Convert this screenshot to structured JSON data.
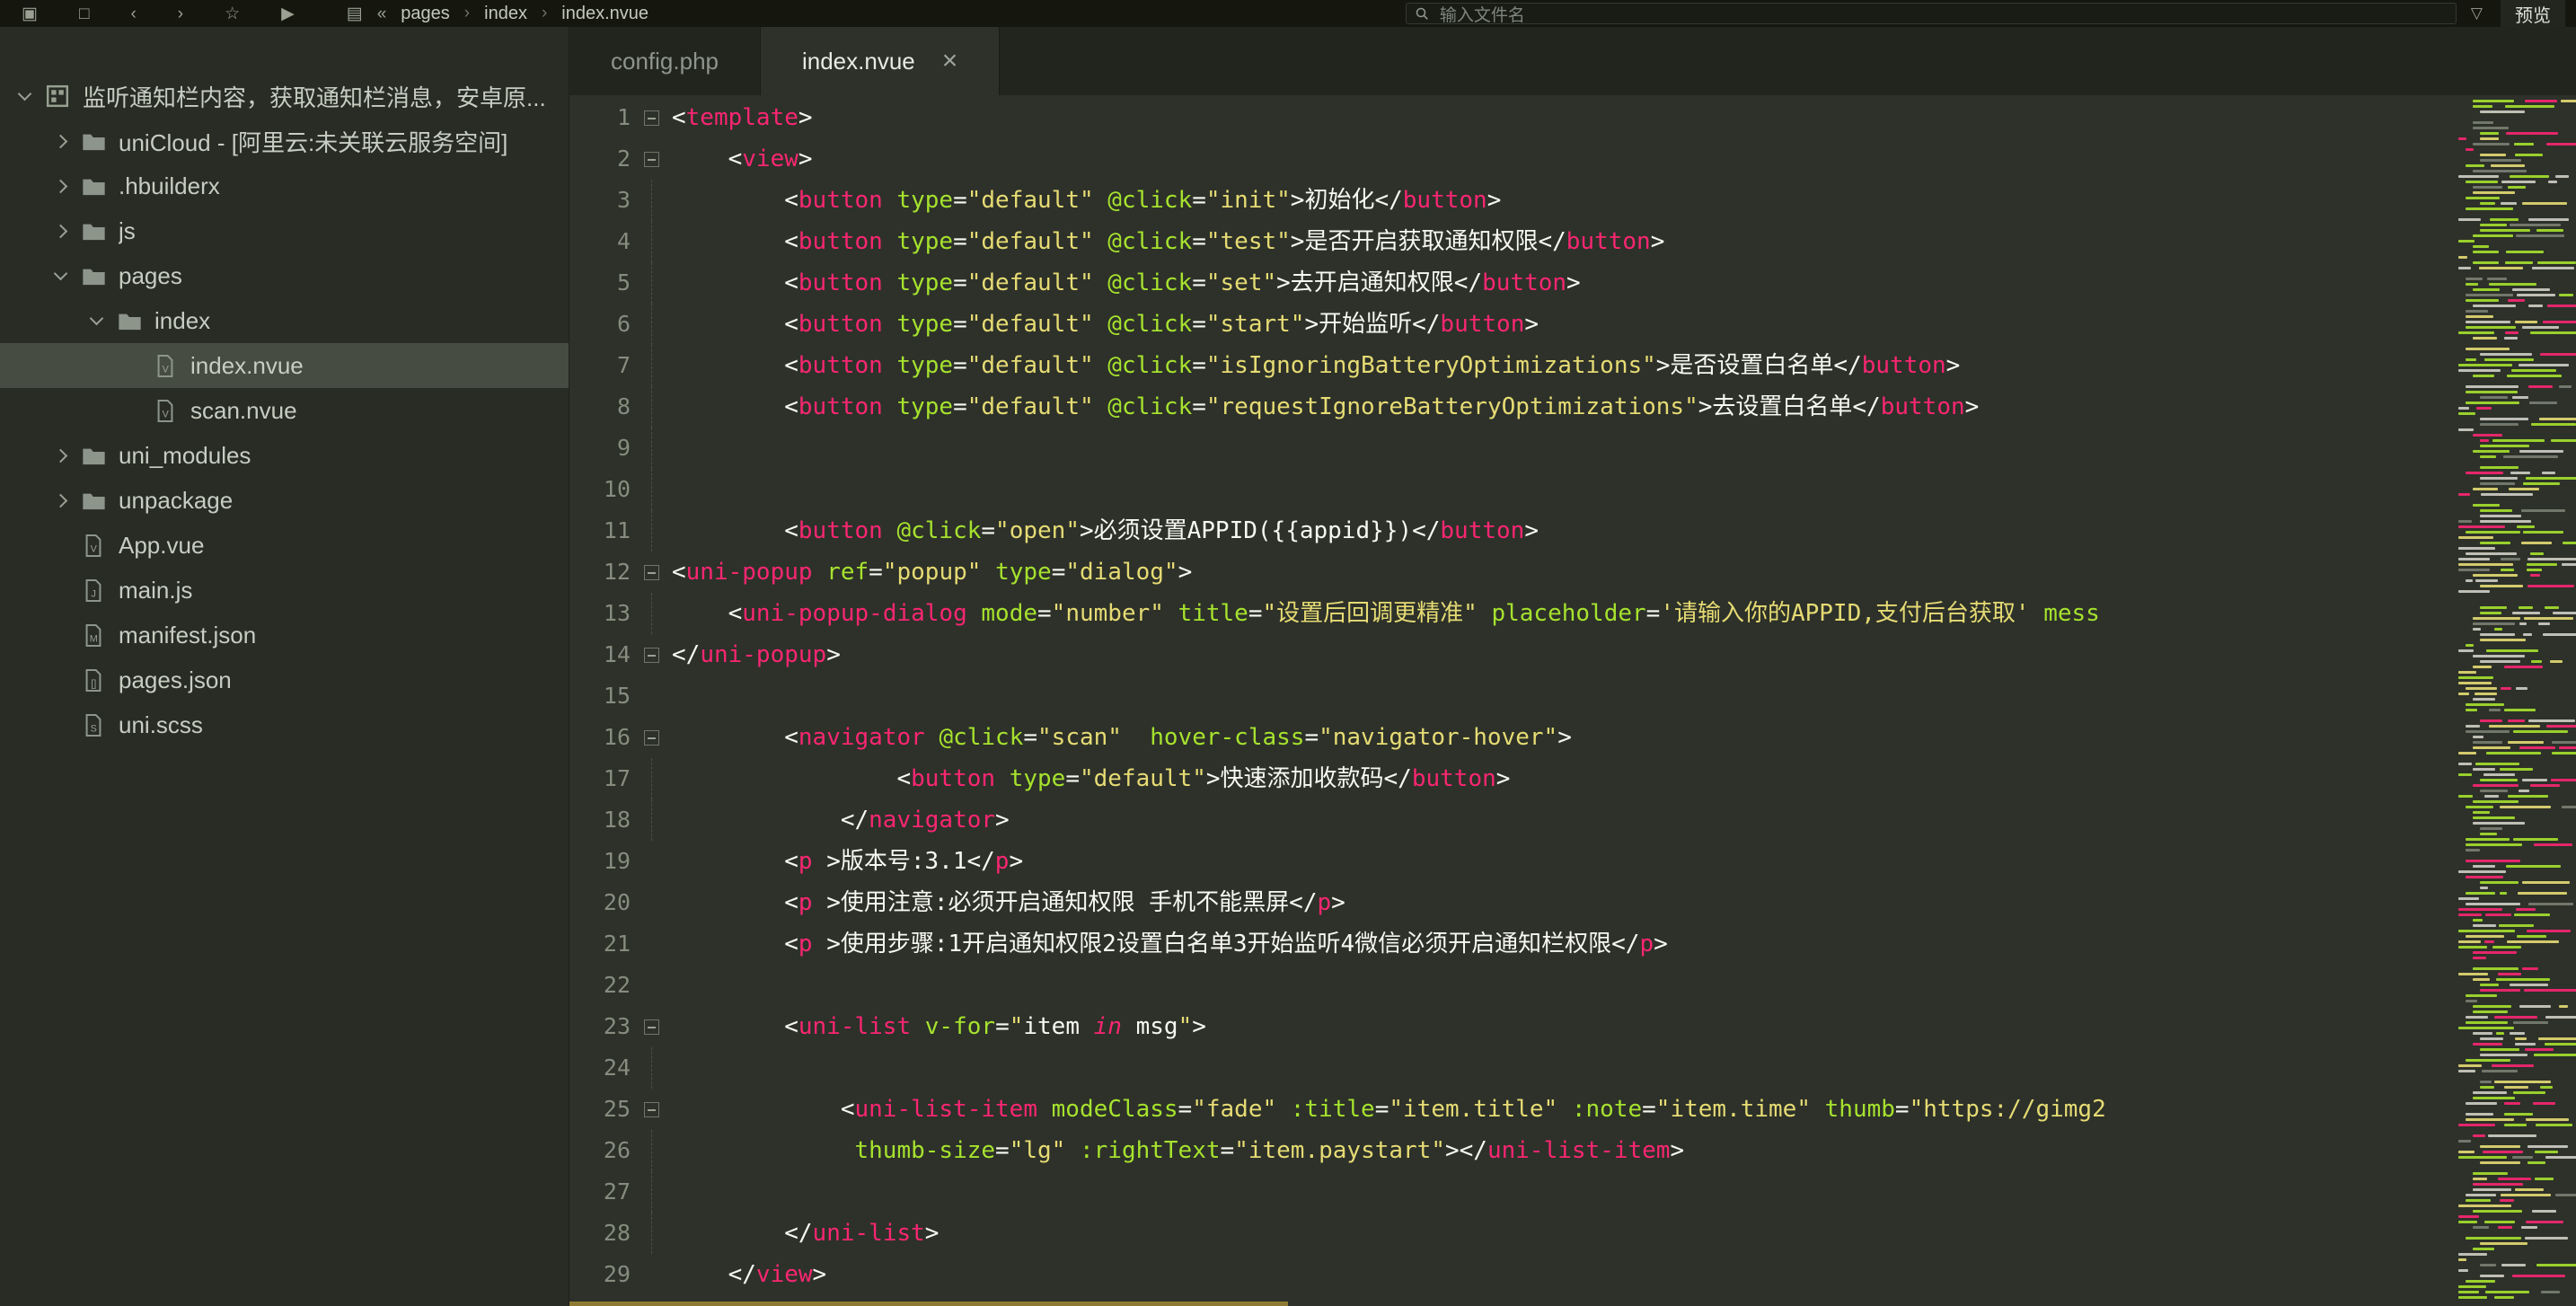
{
  "colors": {
    "tag": "#f92672",
    "attr": "#a6e22e",
    "str": "#e6db74",
    "txt": "#f8f8f2",
    "scrollbar": "#8f7a33"
  },
  "topbar": {
    "breadcrumb": [
      "pages",
      "index",
      "index.nvue"
    ],
    "search_placeholder": "输入文件名",
    "preview_label": "预览"
  },
  "sidebar": {
    "items": [
      {
        "label": "监听通知栏内容，获取通知栏消息，安卓原...",
        "level": 0,
        "arrow": "expanded",
        "icon": "project",
        "selected": false
      },
      {
        "label": "uniCloud - [阿里云:未关联云服务空间]",
        "level": 1,
        "arrow": "collapsed",
        "icon": "folder",
        "selected": false
      },
      {
        "label": ".hbuilderx",
        "level": 1,
        "arrow": "collapsed",
        "icon": "folder",
        "selected": false
      },
      {
        "label": "js",
        "level": 1,
        "arrow": "collapsed",
        "icon": "folder",
        "selected": false
      },
      {
        "label": "pages",
        "level": 1,
        "arrow": "expanded",
        "icon": "folder",
        "selected": false
      },
      {
        "label": "index",
        "level": 2,
        "arrow": "expanded",
        "icon": "folder",
        "selected": false
      },
      {
        "label": "index.nvue",
        "level": 3,
        "arrow": null,
        "icon": "vue",
        "selected": true
      },
      {
        "label": "scan.nvue",
        "level": 3,
        "arrow": null,
        "icon": "vue",
        "selected": false
      },
      {
        "label": "uni_modules",
        "level": 1,
        "arrow": "collapsed",
        "icon": "folder",
        "selected": false
      },
      {
        "label": "unpackage",
        "level": 1,
        "arrow": "collapsed",
        "icon": "folder",
        "selected": false
      },
      {
        "label": "App.vue",
        "level": 1,
        "arrow": null,
        "icon": "vue",
        "selected": false
      },
      {
        "label": "main.js",
        "level": 1,
        "arrow": null,
        "icon": "js",
        "selected": false
      },
      {
        "label": "manifest.json",
        "level": 1,
        "arrow": null,
        "icon": "manifest",
        "selected": false
      },
      {
        "label": "pages.json",
        "level": 1,
        "arrow": null,
        "icon": "json",
        "selected": false
      },
      {
        "label": "uni.scss",
        "level": 1,
        "arrow": null,
        "icon": "scss",
        "selected": false
      }
    ]
  },
  "tabs": [
    {
      "label": "config.php",
      "active": false,
      "closable": false
    },
    {
      "label": "index.nvue",
      "active": true,
      "closable": true
    }
  ],
  "editor": {
    "lines": [
      {
        "fold": true,
        "guide": false,
        "tokens": [
          [
            "p",
            "<"
          ],
          [
            "t",
            "template"
          ],
          [
            "p",
            ">"
          ]
        ]
      },
      {
        "fold": true,
        "guide": false,
        "tokens": [
          [
            "p",
            "    <"
          ],
          [
            "t",
            "view"
          ],
          [
            "p",
            ">"
          ]
        ]
      },
      {
        "fold": false,
        "guide": true,
        "tokens": [
          [
            "p",
            "        <"
          ],
          [
            "t",
            "button"
          ],
          [
            "p",
            " "
          ],
          [
            "a",
            "type"
          ],
          [
            "p",
            "="
          ],
          [
            "s",
            "\"default\""
          ],
          [
            "p",
            " "
          ],
          [
            "a",
            "@click"
          ],
          [
            "p",
            "="
          ],
          [
            "s",
            "\"init\""
          ],
          [
            "p",
            ">初始化</"
          ],
          [
            "t",
            "button"
          ],
          [
            "p",
            ">"
          ]
        ]
      },
      {
        "fold": false,
        "guide": true,
        "tokens": [
          [
            "p",
            "        <"
          ],
          [
            "t",
            "button"
          ],
          [
            "p",
            " "
          ],
          [
            "a",
            "type"
          ],
          [
            "p",
            "="
          ],
          [
            "s",
            "\"default\""
          ],
          [
            "p",
            " "
          ],
          [
            "a",
            "@click"
          ],
          [
            "p",
            "="
          ],
          [
            "s",
            "\"test\""
          ],
          [
            "p",
            ">是否开启获取通知权限</"
          ],
          [
            "t",
            "button"
          ],
          [
            "p",
            ">"
          ]
        ]
      },
      {
        "fold": false,
        "guide": true,
        "tokens": [
          [
            "p",
            "        <"
          ],
          [
            "t",
            "button"
          ],
          [
            "p",
            " "
          ],
          [
            "a",
            "type"
          ],
          [
            "p",
            "="
          ],
          [
            "s",
            "\"default\""
          ],
          [
            "p",
            " "
          ],
          [
            "a",
            "@click"
          ],
          [
            "p",
            "="
          ],
          [
            "s",
            "\"set\""
          ],
          [
            "p",
            ">去开启通知权限</"
          ],
          [
            "t",
            "button"
          ],
          [
            "p",
            ">"
          ]
        ]
      },
      {
        "fold": false,
        "guide": true,
        "tokens": [
          [
            "p",
            "        <"
          ],
          [
            "t",
            "button"
          ],
          [
            "p",
            " "
          ],
          [
            "a",
            "type"
          ],
          [
            "p",
            "="
          ],
          [
            "s",
            "\"default\""
          ],
          [
            "p",
            " "
          ],
          [
            "a",
            "@click"
          ],
          [
            "p",
            "="
          ],
          [
            "s",
            "\"start\""
          ],
          [
            "p",
            ">开始监听</"
          ],
          [
            "t",
            "button"
          ],
          [
            "p",
            ">"
          ]
        ]
      },
      {
        "fold": false,
        "guide": true,
        "tokens": [
          [
            "p",
            "        <"
          ],
          [
            "t",
            "button"
          ],
          [
            "p",
            " "
          ],
          [
            "a",
            "type"
          ],
          [
            "p",
            "="
          ],
          [
            "s",
            "\"default\""
          ],
          [
            "p",
            " "
          ],
          [
            "a",
            "@click"
          ],
          [
            "p",
            "="
          ],
          [
            "s",
            "\"isIgnoringBatteryOptimizations\""
          ],
          [
            "p",
            ">是否设置白名单</"
          ],
          [
            "t",
            "button"
          ],
          [
            "p",
            ">"
          ]
        ]
      },
      {
        "fold": false,
        "guide": true,
        "tokens": [
          [
            "p",
            "        <"
          ],
          [
            "t",
            "button"
          ],
          [
            "p",
            " "
          ],
          [
            "a",
            "type"
          ],
          [
            "p",
            "="
          ],
          [
            "s",
            "\"default\""
          ],
          [
            "p",
            " "
          ],
          [
            "a",
            "@click"
          ],
          [
            "p",
            "="
          ],
          [
            "s",
            "\"requestIgnoreBatteryOptimizations\""
          ],
          [
            "p",
            ">去设置白名单</"
          ],
          [
            "t",
            "button"
          ],
          [
            "p",
            ">"
          ]
        ]
      },
      {
        "fold": false,
        "guide": true,
        "tokens": []
      },
      {
        "fold": false,
        "guide": true,
        "tokens": []
      },
      {
        "fold": false,
        "guide": true,
        "tokens": [
          [
            "p",
            "        <"
          ],
          [
            "t",
            "button"
          ],
          [
            "p",
            " "
          ],
          [
            "a",
            "@click"
          ],
          [
            "p",
            "="
          ],
          [
            "s",
            "\"open\""
          ],
          [
            "p",
            ">必须设置APPID({{appid}})</"
          ],
          [
            "t",
            "button"
          ],
          [
            "p",
            ">"
          ]
        ]
      },
      {
        "fold": true,
        "guide": false,
        "tokens": [
          [
            "p",
            "<"
          ],
          [
            "t",
            "uni-popup"
          ],
          [
            "p",
            " "
          ],
          [
            "a",
            "ref"
          ],
          [
            "p",
            "="
          ],
          [
            "s",
            "\"popup\""
          ],
          [
            "p",
            " "
          ],
          [
            "a",
            "type"
          ],
          [
            "p",
            "="
          ],
          [
            "s",
            "\"dialog\""
          ],
          [
            "p",
            ">"
          ]
        ]
      },
      {
        "fold": false,
        "guide": true,
        "tokens": [
          [
            "p",
            "    <"
          ],
          [
            "t",
            "uni-popup-dialog"
          ],
          [
            "p",
            " "
          ],
          [
            "a",
            "mode"
          ],
          [
            "p",
            "="
          ],
          [
            "s",
            "\"number\""
          ],
          [
            "p",
            " "
          ],
          [
            "a",
            "title"
          ],
          [
            "p",
            "="
          ],
          [
            "s",
            "\"设置后回调更精准\""
          ],
          [
            "p",
            " "
          ],
          [
            "a",
            "placeholder"
          ],
          [
            "p",
            "="
          ],
          [
            "s",
            "'请输入你的APPID,支付后台获取'"
          ],
          [
            "p",
            " "
          ],
          [
            "a",
            "mess"
          ]
        ]
      },
      {
        "fold": true,
        "guide": false,
        "tokens": [
          [
            "p",
            "</"
          ],
          [
            "t",
            "uni-popup"
          ],
          [
            "p",
            ">"
          ]
        ]
      },
      {
        "fold": false,
        "guide": false,
        "tokens": []
      },
      {
        "fold": true,
        "guide": false,
        "tokens": [
          [
            "p",
            "        <"
          ],
          [
            "t",
            "navigator"
          ],
          [
            "p",
            " "
          ],
          [
            "a",
            "@click"
          ],
          [
            "p",
            "="
          ],
          [
            "s",
            "\"scan\""
          ],
          [
            "p",
            "  "
          ],
          [
            "a",
            "hover-class"
          ],
          [
            "p",
            "="
          ],
          [
            "s",
            "\"navigator-hover\""
          ],
          [
            "p",
            ">"
          ]
        ]
      },
      {
        "fold": false,
        "guide": true,
        "tokens": [
          [
            "p",
            "                <"
          ],
          [
            "t",
            "button"
          ],
          [
            "p",
            " "
          ],
          [
            "a",
            "type"
          ],
          [
            "p",
            "="
          ],
          [
            "s",
            "\"default\""
          ],
          [
            "p",
            ">快速添加收款码</"
          ],
          [
            "t",
            "button"
          ],
          [
            "p",
            ">"
          ]
        ]
      },
      {
        "fold": false,
        "guide": true,
        "tokens": [
          [
            "p",
            "            </"
          ],
          [
            "t",
            "navigator"
          ],
          [
            "p",
            ">"
          ]
        ]
      },
      {
        "fold": false,
        "guide": false,
        "tokens": [
          [
            "p",
            "        <"
          ],
          [
            "t",
            "p"
          ],
          [
            "p",
            " >版本号:3.1</"
          ],
          [
            "t",
            "p"
          ],
          [
            "p",
            ">"
          ]
        ]
      },
      {
        "fold": false,
        "guide": false,
        "tokens": [
          [
            "p",
            "        <"
          ],
          [
            "t",
            "p"
          ],
          [
            "p",
            " >使用注意:必须开启通知权限 手机不能黑屏</"
          ],
          [
            "t",
            "p"
          ],
          [
            "p",
            ">"
          ]
        ]
      },
      {
        "fold": false,
        "guide": false,
        "tokens": [
          [
            "p",
            "        <"
          ],
          [
            "t",
            "p"
          ],
          [
            "p",
            " >使用步骤:1开启通知权限2设置白名单3开始监听4微信必须开启通知栏权限</"
          ],
          [
            "t",
            "p"
          ],
          [
            "p",
            ">"
          ]
        ]
      },
      {
        "fold": false,
        "guide": false,
        "tokens": []
      },
      {
        "fold": true,
        "guide": false,
        "tokens": [
          [
            "p",
            "        <"
          ],
          [
            "t",
            "uni-list"
          ],
          [
            "p",
            " "
          ],
          [
            "a",
            "v-for"
          ],
          [
            "p",
            "="
          ],
          [
            "s",
            "\""
          ],
          [
            "p",
            "item "
          ],
          [
            "k",
            "in"
          ],
          [
            "p",
            " msg"
          ],
          [
            "s",
            "\""
          ],
          [
            "p",
            ">"
          ]
        ]
      },
      {
        "fold": false,
        "guide": true,
        "tokens": []
      },
      {
        "fold": true,
        "guide": false,
        "tokens": [
          [
            "p",
            "            <"
          ],
          [
            "t",
            "uni-list-item"
          ],
          [
            "p",
            " "
          ],
          [
            "a",
            "modeClass"
          ],
          [
            "p",
            "="
          ],
          [
            "s",
            "\"fade\""
          ],
          [
            "p",
            " "
          ],
          [
            "a",
            ":title"
          ],
          [
            "p",
            "="
          ],
          [
            "s",
            "\"item.title\""
          ],
          [
            "p",
            " "
          ],
          [
            "a",
            ":note"
          ],
          [
            "p",
            "="
          ],
          [
            "s",
            "\"item.time\""
          ],
          [
            "p",
            " "
          ],
          [
            "a",
            "thumb"
          ],
          [
            "p",
            "="
          ],
          [
            "s",
            "\"https://gimg2"
          ]
        ]
      },
      {
        "fold": false,
        "guide": true,
        "tokens": [
          [
            "p",
            "             "
          ],
          [
            "a",
            "thumb-size"
          ],
          [
            "p",
            "="
          ],
          [
            "s",
            "\"lg\""
          ],
          [
            "p",
            " "
          ],
          [
            "a",
            ":rightText"
          ],
          [
            "p",
            "="
          ],
          [
            "s",
            "\"item.paystart\""
          ],
          [
            "p",
            "></"
          ],
          [
            "t",
            "uni-list-item"
          ],
          [
            "p",
            ">"
          ]
        ]
      },
      {
        "fold": false,
        "guide": true,
        "tokens": []
      },
      {
        "fold": false,
        "guide": true,
        "tokens": [
          [
            "p",
            "        </"
          ],
          [
            "t",
            "uni-list"
          ],
          [
            "p",
            ">"
          ]
        ]
      },
      {
        "fold": false,
        "guide": false,
        "tokens": [
          [
            "p",
            "    </"
          ],
          [
            "t",
            "view"
          ],
          [
            "p",
            ">"
          ]
        ]
      }
    ]
  }
}
